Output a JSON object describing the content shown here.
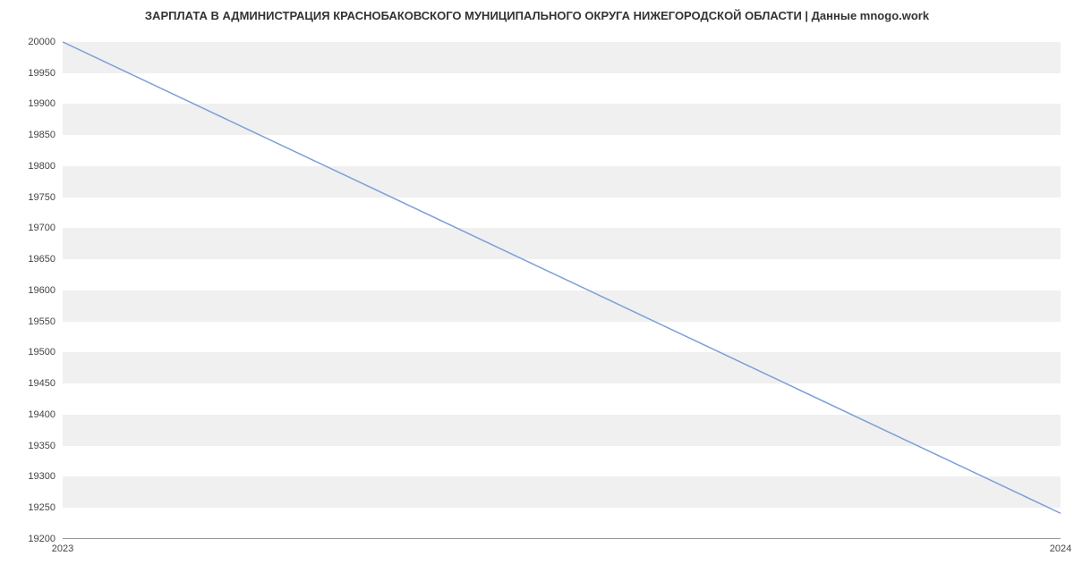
{
  "chart_data": {
    "type": "line",
    "title": "ЗАРПЛАТА В АДМИНИСТРАЦИЯ КРАСНОБАКОВСКОГО МУНИЦИПАЛЬНОГО ОКРУГА НИЖЕГОРОДСКОЙ ОБЛАСТИ | Данные mnogo.work",
    "x": [
      2023,
      2024
    ],
    "values": [
      20000,
      19240
    ],
    "xlabel": "",
    "ylabel": "",
    "xticks": [
      2023,
      2024
    ],
    "yticks": [
      19200,
      19250,
      19300,
      19350,
      19400,
      19450,
      19500,
      19550,
      19600,
      19650,
      19700,
      19750,
      19800,
      19850,
      19900,
      19950,
      20000
    ],
    "ylim": [
      19200,
      20020
    ],
    "xlim": [
      2023,
      2024
    ],
    "line_color": "#7a9edb"
  }
}
